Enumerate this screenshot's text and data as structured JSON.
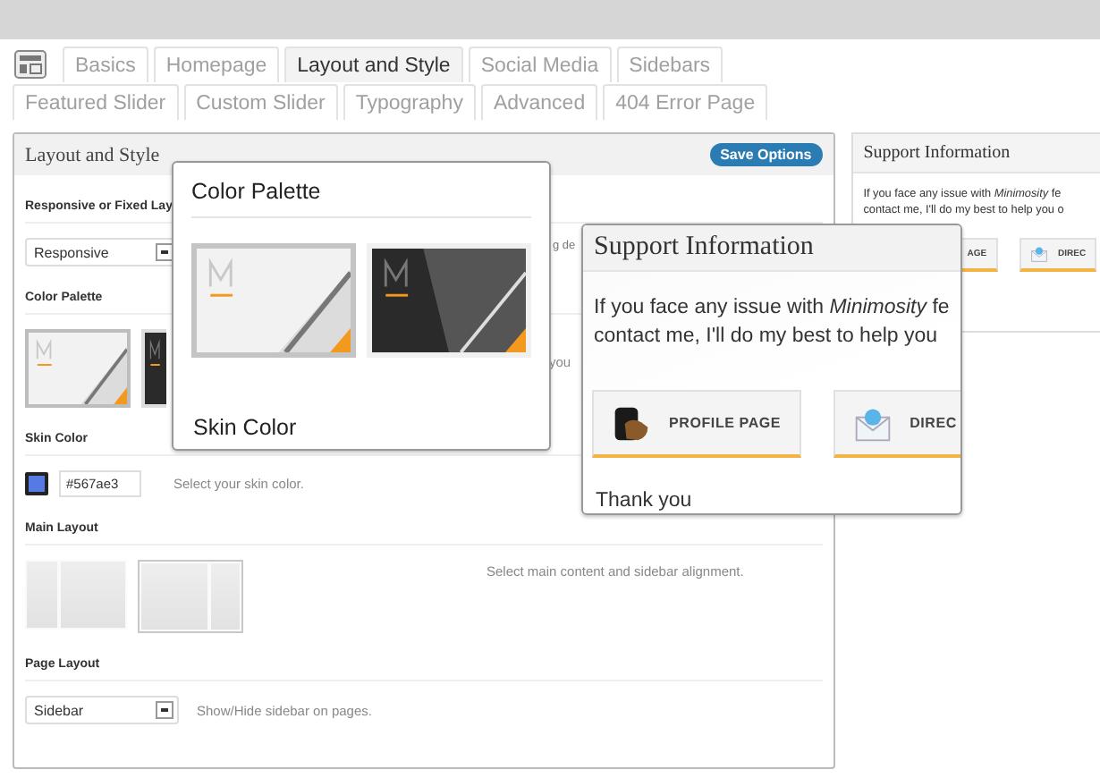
{
  "tab_rows": [
    [
      {
        "label": "Basics",
        "selected": false
      },
      {
        "label": "Homepage",
        "selected": false
      },
      {
        "label": "Layout and Style",
        "selected": true
      },
      {
        "label": "Social Media",
        "selected": false
      },
      {
        "label": "Sidebars",
        "selected": false
      }
    ],
    [
      {
        "label": "Featured Slider",
        "selected": false
      },
      {
        "label": "Custom Slider",
        "selected": false
      },
      {
        "label": "Typography",
        "selected": false
      },
      {
        "label": "Advanced",
        "selected": false
      },
      {
        "label": "404 Error Page",
        "selected": false
      }
    ]
  ],
  "main_panel": {
    "title": "Layout and Style",
    "save_button": "Save Options",
    "responsive": {
      "label": "Responsive or Fixed Lay",
      "value": "Responsive",
      "description": "g de"
    },
    "color_palette": {
      "label": "Color Palette",
      "options": [
        {
          "kind": "light",
          "selected": true
        },
        {
          "kind": "dark",
          "selected": false
        }
      ],
      "description": "you"
    },
    "skin_color": {
      "label": "Skin Color",
      "color": "#567ae3",
      "value": "#567ae3",
      "description": "Select your skin color."
    },
    "main_layout": {
      "label": "Main Layout",
      "options": [
        {
          "kind": "left-sidebar",
          "selected": false
        },
        {
          "kind": "right-sidebar",
          "selected": true
        }
      ],
      "description": "Select main content and sidebar alignment."
    },
    "page_layout": {
      "label": "Page Layout",
      "value": "Sidebar",
      "description": "Show/Hide sidebar on pages."
    }
  },
  "support_panel": {
    "title": "Support Information",
    "lines": [
      "If you face any issue with *Minimosity* fe",
      "contact me, I'll do my best to help you o"
    ],
    "buttons": [
      {
        "label": "AGE",
        "kind": "profile"
      },
      {
        "label": "DIREC",
        "kind": "email"
      }
    ]
  },
  "palette_callout": {
    "title": "Color Palette",
    "options": [
      {
        "kind": "light",
        "selected": true
      },
      {
        "kind": "dark",
        "selected": false
      }
    ],
    "next_heading": "Skin Color"
  },
  "support_callout": {
    "title": "Support Information",
    "lines": [
      "If you face any issue with *Minimosity* fe",
      "contact me, I'll do my best to help you"
    ],
    "buttons": [
      {
        "label": "PROFILE PAGE",
        "kind": "profile"
      },
      {
        "label": "DIREC",
        "kind": "email"
      }
    ],
    "closing": "Thank you"
  }
}
